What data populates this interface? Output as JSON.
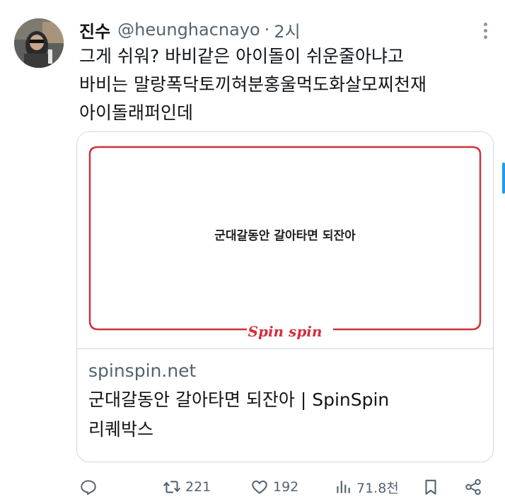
{
  "author": {
    "name": "진수",
    "handle": "@heunghacnayo",
    "separator": "·",
    "time": "2시"
  },
  "tweet": {
    "lines": [
      "그게 쉬워? 바비같은 아이돌이 쉬운줄아냐고",
      "바비는 말랑폭닥토끼혀분홍울먹도화살모찌천재",
      "아이돌래퍼인데"
    ]
  },
  "card": {
    "image_headline": "군대갈동안 갈아타면 되잔아",
    "image_logo": "Spin spin",
    "domain": "spinspin.net",
    "title_line1": "군대갈동안 갈아타면 되잔아 | SpinSpin",
    "title_line2": "리퀘박스",
    "frame_color": "#d0313c"
  },
  "actions": {
    "reply_count": "",
    "retweet_count": "221",
    "like_count": "192",
    "views_count": "71.8천"
  },
  "icons": [
    "more-icon",
    "reply-icon",
    "retweet-icon",
    "like-icon",
    "views-icon",
    "bookmark-icon",
    "share-icon"
  ]
}
